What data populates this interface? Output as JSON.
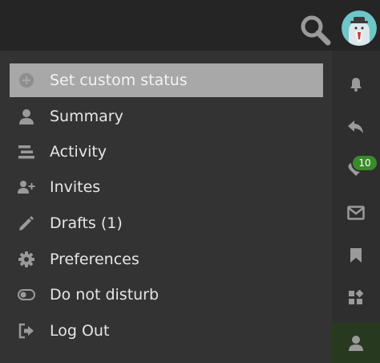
{
  "header": {
    "search_icon": "search-icon",
    "avatar_icon": "user-avatar"
  },
  "menu": {
    "items": [
      {
        "label": "Set custom status",
        "icon": "plus-circle-icon",
        "active": true
      },
      {
        "label": "Summary",
        "icon": "user-icon"
      },
      {
        "label": "Activity",
        "icon": "stream-icon"
      },
      {
        "label": "Invites",
        "icon": "user-plus-icon"
      },
      {
        "label": "Drafts (1)",
        "icon": "pencil-icon"
      },
      {
        "label": "Preferences",
        "icon": "gear-icon"
      },
      {
        "label": "Do not disturb",
        "icon": "toggle-off-icon"
      },
      {
        "label": "Log Out",
        "icon": "sign-out-icon"
      }
    ]
  },
  "rail": {
    "items": [
      {
        "icon": "bell-icon"
      },
      {
        "icon": "reply-icon"
      },
      {
        "icon": "heart-icon",
        "badge": "10"
      },
      {
        "icon": "envelope-icon"
      },
      {
        "icon": "bookmark-icon"
      },
      {
        "icon": "grid-icon"
      },
      {
        "icon": "user-icon",
        "active": true
      }
    ]
  },
  "colors": {
    "header_bg": "#252525",
    "panel_bg": "#333333",
    "active_item_bg": "#a8a8a8",
    "badge_bg": "#3a8b2a",
    "active_rail_bg": "#27391f",
    "icon_gray": "#9a9a9a"
  }
}
